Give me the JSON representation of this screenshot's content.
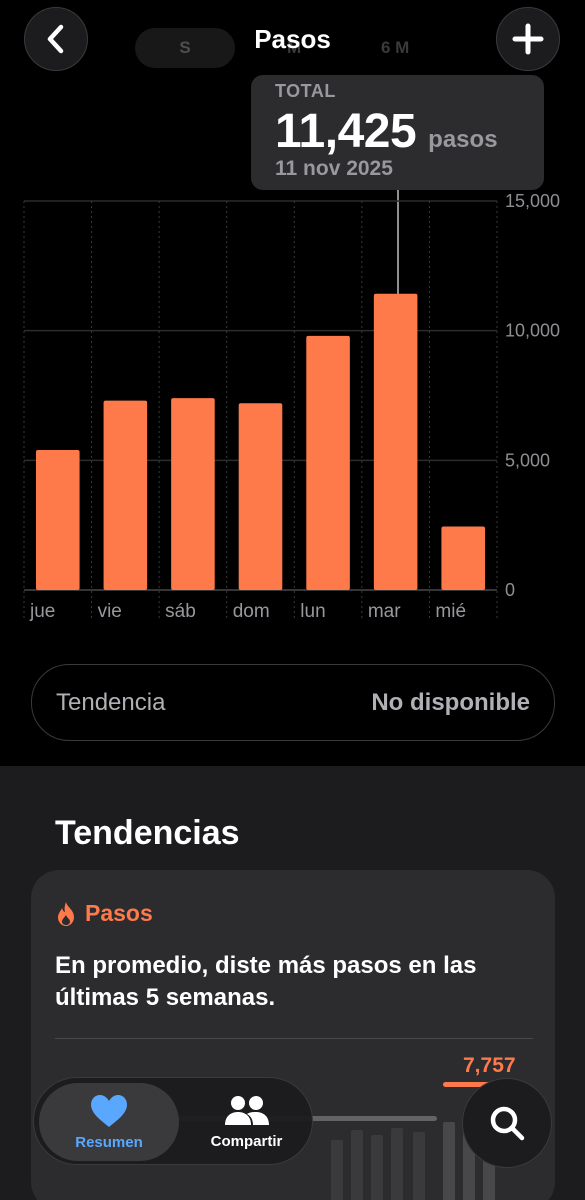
{
  "header": {
    "title": "Pasos",
    "back_icon": "chevron-left-icon",
    "add_icon": "plus-icon",
    "segments": [
      "S",
      "M",
      "6 M"
    ]
  },
  "tooltip": {
    "label": "TOTAL",
    "value": "11,425",
    "unit": "pasos",
    "date": "11 nov 2025"
  },
  "chart_data": {
    "type": "bar",
    "categories": [
      "jue",
      "vie",
      "sáb",
      "dom",
      "lun",
      "mar",
      "mié"
    ],
    "values": [
      5400,
      7300,
      7400,
      7200,
      9800,
      11425,
      2450
    ],
    "ylim": [
      0,
      15000
    ],
    "yticks": [
      "15,000",
      "10,000",
      "5,000",
      "0"
    ],
    "ytick_values": [
      15000,
      10000,
      5000,
      0
    ],
    "bar_color": "#ff7a4a",
    "grid": true,
    "highlight_index": 5
  },
  "trend_pill": {
    "label": "Tendencia",
    "value": "No disponible"
  },
  "trends": {
    "section_title": "Tendencias",
    "card_title": "Pasos",
    "card_icon": "flame-icon",
    "card_text": "En promedio, diste más pasos en las últimas 5 semanas.",
    "highlight_value": "7,757",
    "accent_color": "#ff7a4a"
  },
  "tabbar": {
    "resumen_label": "Resumen",
    "resumen_icon": "heart-icon",
    "compartir_label": "Compartir",
    "compartir_icon": "people-icon",
    "search_icon": "search-icon"
  }
}
